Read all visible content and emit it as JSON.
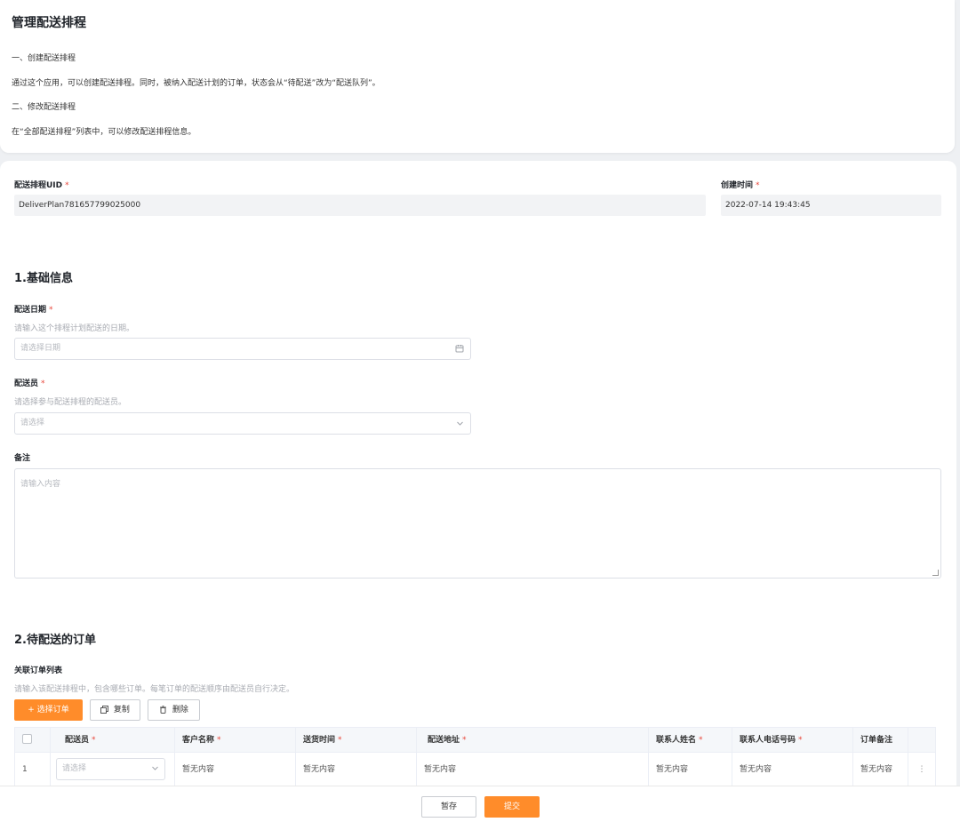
{
  "page": {
    "title": "管理配送排程",
    "guide": [
      {
        "heading": "一、创建配送排程",
        "text": "通过这个应用，可以创建配送排程。同时，被纳入配送计划的订单，状态会从“待配送”改为“配送队列”。"
      },
      {
        "heading": "二、修改配送排程",
        "text": "在“全部配送排程”列表中，可以修改配送排程信息。"
      }
    ]
  },
  "meta": {
    "uid_label": "配送排程UID",
    "uid_value": "DeliverPlan781657799025000",
    "created_label": "创建时间",
    "created_value": "2022-07-14 19:43:45",
    "required_mark": "*"
  },
  "basic": {
    "section_title": "1.基础信息",
    "date_label": "配送日期",
    "date_hint": "请输入这个排程计划配送的日期。",
    "date_placeholder": "请选择日期",
    "courier_label": "配送员",
    "courier_hint": "请选择参与配送排程的配送员。",
    "courier_placeholder": "请选择",
    "note_label": "备注",
    "note_placeholder": "请输入内容"
  },
  "orders": {
    "section_title": "2.待配送的订单",
    "list_label": "关联订单列表",
    "list_hint": "请输入该配送排程中，包含哪些订单。每笔订单的配送顺序由配送员自行决定。",
    "select_button": "+ 选择订单",
    "copy_button": "复制",
    "delete_button": "删除",
    "columns": [
      {
        "label": "配送员",
        "required": true
      },
      {
        "label": "客户名称",
        "required": true
      },
      {
        "label": "送货时间",
        "required": true
      },
      {
        "label": "配送地址",
        "required": true
      },
      {
        "label": "联系人姓名",
        "required": true
      },
      {
        "label": "联系人电话号码",
        "required": true
      },
      {
        "label": "订单备注",
        "required": false
      }
    ],
    "rows": [
      {
        "index": "1",
        "courier_placeholder": "请选择",
        "customer": "暂无内容",
        "delivery_time": "暂无内容",
        "address": "暂无内容",
        "contact_name": "暂无内容",
        "contact_phone": "暂无内容",
        "note": "暂无内容",
        "more": "⋮"
      }
    ]
  },
  "footer": {
    "save_draft": "暂存",
    "submit": "提交"
  },
  "colors": {
    "accent": "#ff8c2a",
    "required": "#e8473b"
  }
}
